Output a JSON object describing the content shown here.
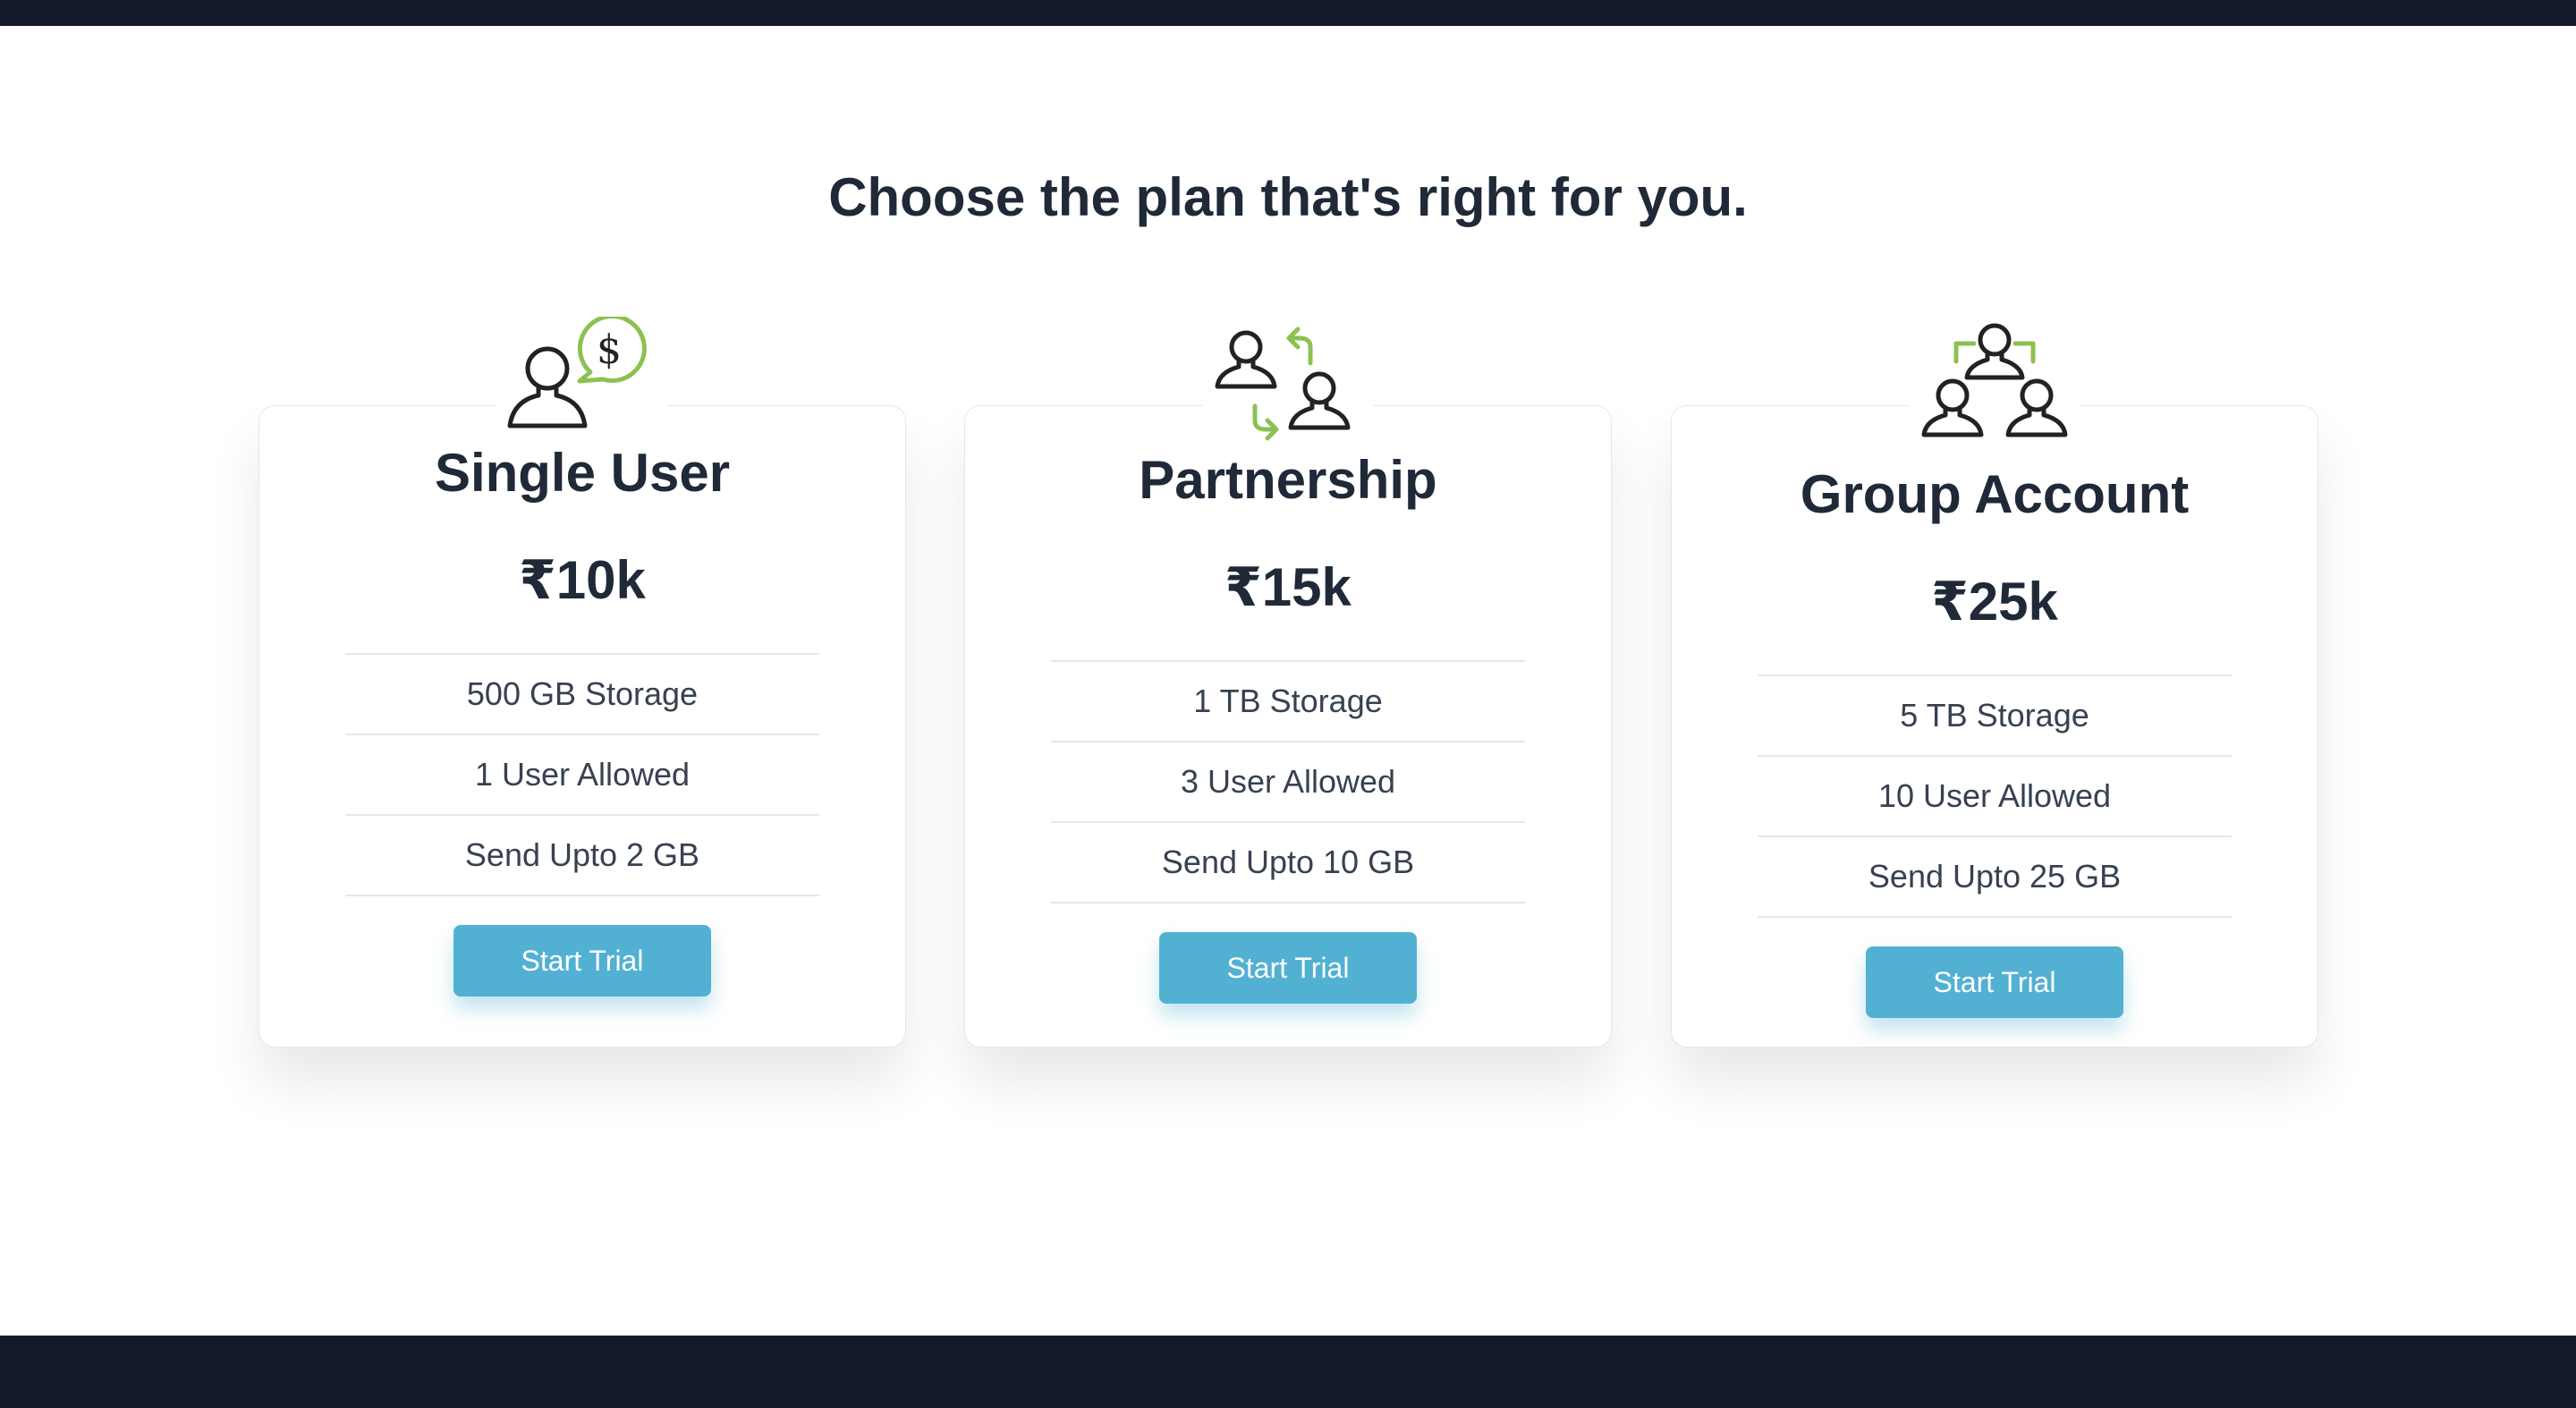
{
  "heading": "Choose the plan that's right for you.",
  "plans": [
    {
      "icon": "user-dollar-icon",
      "name": "Single User",
      "price": "₹10k",
      "features": [
        "500 GB Storage",
        "1 User Allowed",
        "Send Upto 2 GB"
      ],
      "button": "Start Trial"
    },
    {
      "icon": "partnership-exchange-icon",
      "name": "Partnership",
      "price": "₹15k",
      "features": [
        "1 TB Storage",
        "3 User Allowed",
        "Send Upto 10 GB"
      ],
      "button": "Start Trial"
    },
    {
      "icon": "group-users-icon",
      "name": "Group Account",
      "price": "₹25k",
      "features": [
        "5 TB Storage",
        "10 User Allowed",
        "Send Upto 25 GB"
      ],
      "button": "Start Trial"
    }
  ],
  "colors": {
    "dark_bar": "#121a2a",
    "accent_button": "#52b1d2",
    "icon_green": "#8cc152",
    "text_dark": "#1f2937"
  }
}
